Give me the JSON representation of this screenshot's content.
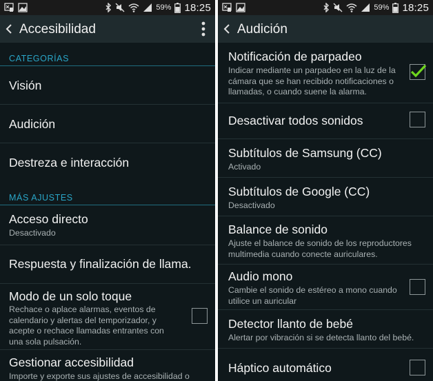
{
  "status_bar": {
    "battery_percent": "59%",
    "time": "18:25"
  },
  "left": {
    "title": "Accesibilidad",
    "section_categories": "CATEGORÍAS",
    "categories": [
      "Visión",
      "Audición",
      "Destreza e interacción"
    ],
    "section_more": "MÁS AJUSTES",
    "acceso_directo": {
      "title": "Acceso directo",
      "sub": "Desactivado"
    },
    "respuesta": {
      "title": "Respuesta y finalización de llama."
    },
    "modo_toque": {
      "title": "Modo de un solo toque",
      "sub": [
        "Rechace o aplace alarmas, eventos de",
        "calendario y alertas del temporizador, y",
        "acepte o rechace llamadas entrantes con",
        "una sola pulsación."
      ],
      "checked": false
    },
    "gestionar": {
      "title": "Gestionar accesibilidad",
      "sub": [
        "Importe y exporte sus ajustes de accesibilidad o"
      ]
    }
  },
  "right": {
    "title": "Audición",
    "items": [
      {
        "title": "Notificación de parpadeo",
        "sub": [
          "Indicar mediante un parpadeo en la luz de la",
          "cámara que se han recibido notificaciones o",
          "llamadas, o cuando suene la alarma."
        ],
        "checked": true
      },
      {
        "title": "Desactivar todos sonidos",
        "checked": false
      },
      {
        "title": "Subtítulos de Samsung (CC)",
        "sub": [
          "Activado"
        ]
      },
      {
        "title": "Subtítulos de Google (CC)",
        "sub": [
          "Desactivado"
        ]
      },
      {
        "title": "Balance de sonido",
        "sub": [
          "Ajuste el balance de sonido de los reproductores",
          "multimedia cuando conecte auriculares."
        ]
      },
      {
        "title": "Audio mono",
        "sub": [
          "Cambie el sonido de estéreo a mono cuando",
          "utilice un auricular"
        ],
        "checked": false
      },
      {
        "title": "Detector llanto de bebé",
        "sub": [
          "Alertar por vibración si se detecta llanto del bebé."
        ]
      },
      {
        "title": "Háptico automático",
        "checked": false
      }
    ]
  },
  "colors": {
    "background": "#0f181b",
    "action_bar": "#1f2b2e",
    "section_header": "#2aa6c8",
    "check_mark": "#6fd61e"
  },
  "icons": [
    "screenshot-icon",
    "gallery-icon",
    "bluetooth-icon",
    "mute-icon",
    "wifi-icon",
    "signal-icon",
    "battery-icon",
    "back-arrow-icon",
    "overflow-menu-icon",
    "check-icon"
  ]
}
